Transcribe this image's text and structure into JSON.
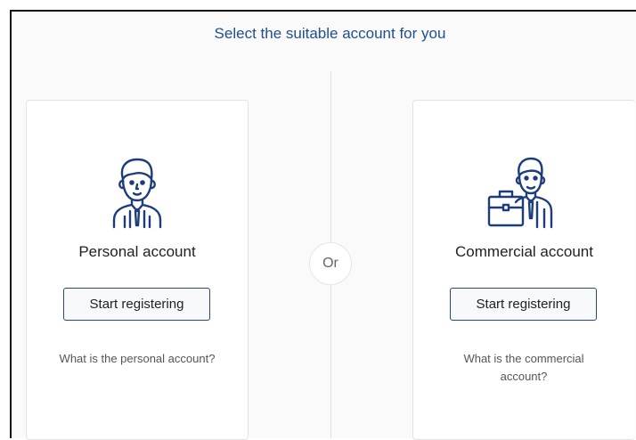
{
  "header": {
    "title": "Select the suitable account for you"
  },
  "separator": {
    "label": "Or"
  },
  "cards": {
    "personal": {
      "title": "Personal account",
      "button_label": "Start registering",
      "info_link": "What is the personal account?",
      "icon": "person-icon"
    },
    "commercial": {
      "title": "Commercial account",
      "button_label": "Start registering",
      "info_link": "What is the commercial account?",
      "icon": "businessman-briefcase-icon"
    }
  },
  "colors": {
    "accent": "#1f4f8f",
    "icon_stroke": "#1c3d7a",
    "button_border": "#2a4a6b"
  }
}
